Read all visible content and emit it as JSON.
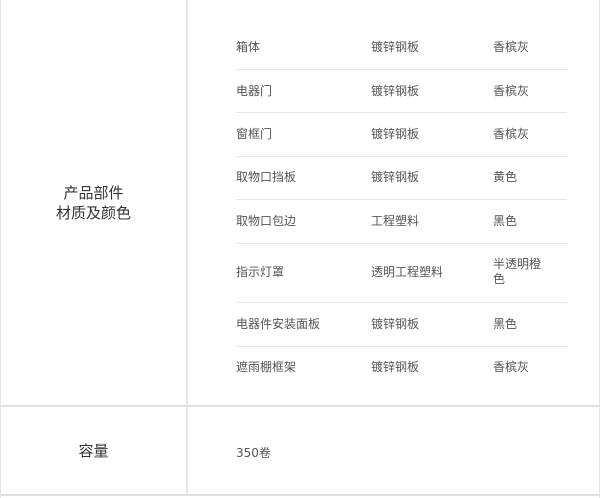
{
  "parts": {
    "label_line1": "产品部件",
    "label_line2": "材质及颜色",
    "rows": [
      {
        "part": "箱体",
        "material": "镀锌钢板",
        "color": "香槟灰"
      },
      {
        "part": "电器门",
        "material": "镀锌钢板",
        "color": "香槟灰"
      },
      {
        "part": "窗框门",
        "material": "镀锌钢板",
        "color": "香槟灰"
      },
      {
        "part": "取物口挡板",
        "material": "镀锌钢板",
        "color": "黄色"
      },
      {
        "part": "取物口包边",
        "material": "工程塑料",
        "color": "黑色"
      },
      {
        "part": "指示灯罩",
        "material": "透明工程塑料",
        "color": "半透明橙色"
      },
      {
        "part": "电器件安装面板",
        "material": "镀锌钢板",
        "color": "黑色"
      },
      {
        "part": "遮雨棚框架",
        "material": "镀锌钢板",
        "color": "香槟灰"
      }
    ]
  },
  "capacity": {
    "label": "容量",
    "value": "350卷"
  }
}
